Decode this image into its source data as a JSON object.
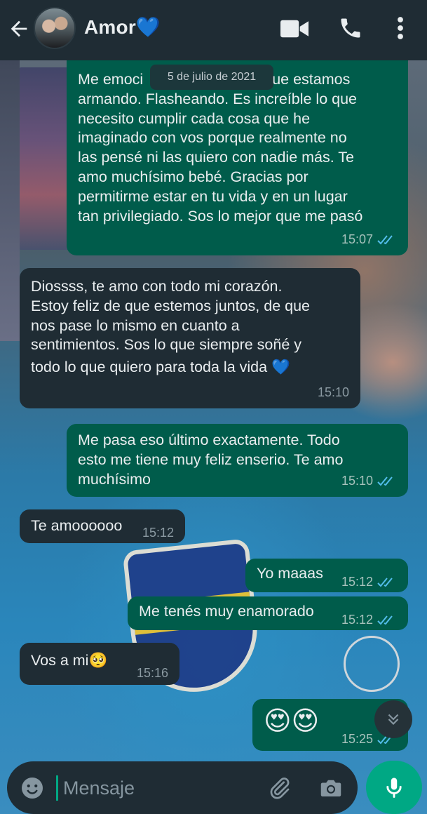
{
  "header": {
    "contact_name": "Amor",
    "contact_emoji": "💙",
    "icons": [
      "back-arrow-icon",
      "avatar",
      "video-call-icon",
      "phone-icon",
      "more-vert-icon"
    ]
  },
  "chat": {
    "date_chip": "5 de julio de 2021",
    "messages": [
      {
        "direction": "outgoing",
        "text": "Me emociona todo lo que estamos armando. Flasheando. Es increíble lo que necesito cumplir cada cosa que he imaginado con vos porque realmente no las pensé ni las quiero con nadie más. Te amo muchísimo bebé. Gracias por permitirme estar en tu vida y en un lugar tan privilegiado. Sos lo mejor que me pasó",
        "lines": [
          "Me emoci",
          "armando. Flasheando. Es increíble lo que",
          "necesito cumplir cada cosa que he",
          "imaginado con vos porque realmente no",
          "las pensé ni las quiero con nadie más. Te",
          "amo muchísimo bebé. Gracias por",
          "permitirme estar en tu vida y en un lugar",
          "tan privilegiado. Sos lo mejor que me pasó"
        ],
        "first_line_tail": "ue estamos",
        "time": "15:07",
        "status": "read"
      },
      {
        "direction": "incoming",
        "lines": [
          "Diossss, te amo con todo mi corazón.",
          "Estoy feliz de que estemos juntos, de que",
          "nos pase lo mismo en cuanto a",
          "sentimientos. Sos lo que siempre soñé y",
          "todo lo que quiero para toda la vida 💙"
        ],
        "time": "15:10"
      },
      {
        "direction": "outgoing",
        "lines": [
          "Me pasa eso último exactamente. Todo",
          "esto me tiene muy feliz enserio. Te amo",
          "muchísimo"
        ],
        "time": "15:10",
        "status": "read"
      },
      {
        "direction": "incoming",
        "text": "Te amoooooo",
        "time": "15:12"
      },
      {
        "direction": "outgoing",
        "text": "Yo maaas",
        "time": "15:12",
        "status": "read"
      },
      {
        "direction": "outgoing",
        "text": "Me tenés muy enamorado",
        "time": "15:12",
        "status": "read"
      },
      {
        "direction": "incoming",
        "text": "Vos a mi🥺",
        "time": "15:16"
      },
      {
        "direction": "outgoing",
        "text": "😍😍",
        "time": "15:25",
        "status": "read"
      }
    ]
  },
  "composer": {
    "placeholder": "Mensaje",
    "icons": [
      "emoji-icon",
      "attach-icon",
      "camera-icon",
      "mic-icon"
    ]
  },
  "colors": {
    "header_bg": "#1f2c34",
    "outgoing_bubble": "#005c4b",
    "incoming_bubble": "#1f2c34",
    "accent": "#00a884",
    "read_ticks": "#53bdeb"
  }
}
